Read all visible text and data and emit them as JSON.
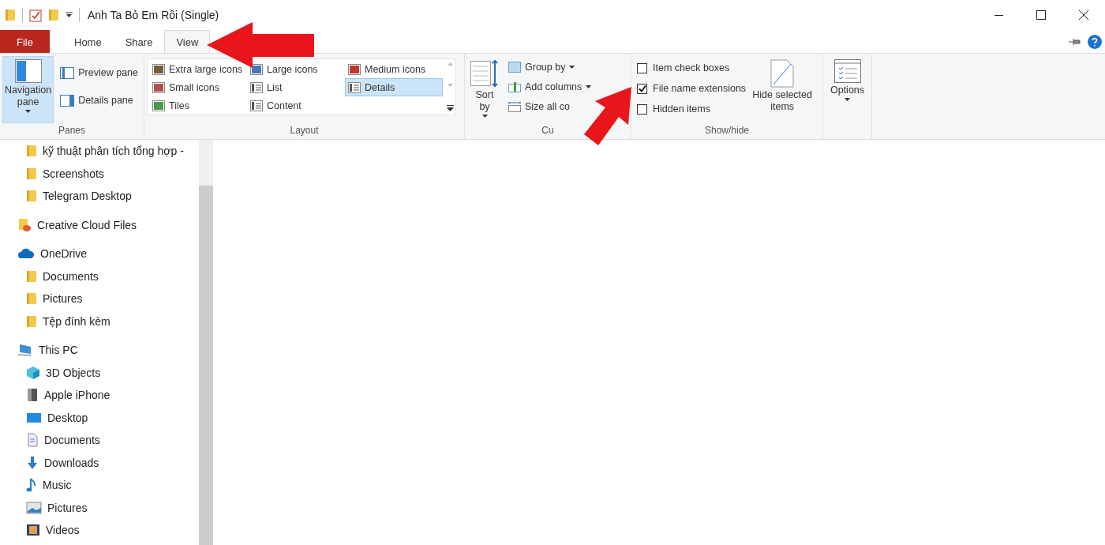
{
  "window": {
    "title": "Anh Ta Bỏ Em Rồi (Single)"
  },
  "tabs": [
    {
      "label": "File",
      "kind": "file",
      "selected": false
    },
    {
      "label": "Home",
      "kind": "tab",
      "selected": false
    },
    {
      "label": "Share",
      "kind": "tab",
      "selected": false
    },
    {
      "label": "View",
      "kind": "tab",
      "selected": true
    }
  ],
  "ribbon": {
    "panes": {
      "label": "Panes",
      "large": {
        "label": "Navigation pane",
        "on": true
      },
      "buttons": [
        {
          "label": "Preview pane",
          "kind": "preview",
          "on": false
        },
        {
          "label": "Details pane",
          "kind": "details",
          "on": false
        }
      ]
    },
    "layout": {
      "label": "Layout",
      "options": [
        {
          "label": "Extra large icons",
          "kind": "xl",
          "selected": false
        },
        {
          "label": "Large icons",
          "kind": "large",
          "selected": false
        },
        {
          "label": "Medium icons",
          "kind": "medium",
          "selected": false
        },
        {
          "label": "Small icons",
          "kind": "small",
          "selected": false
        },
        {
          "label": "List",
          "kind": "list",
          "selected": false
        },
        {
          "label": "Details",
          "kind": "details",
          "selected": true
        },
        {
          "label": "Tiles",
          "kind": "tiles",
          "selected": false
        },
        {
          "label": "Content",
          "kind": "content",
          "selected": false
        }
      ]
    },
    "current_view": {
      "label": "Cu",
      "sort": "Sort by",
      "buttons": [
        {
          "label": "Group by",
          "kind": "group",
          "dropdown": true
        },
        {
          "label": "Add columns",
          "kind": "add",
          "dropdown": true
        },
        {
          "label": "Size all co",
          "kind": "size",
          "dropdown": false
        }
      ]
    },
    "show_hide": {
      "label": "Show/hide",
      "checkboxes": [
        {
          "label": "Item check boxes",
          "checked": false
        },
        {
          "label": "File name extensions",
          "checked": true
        },
        {
          "label": "Hidden items",
          "checked": false
        }
      ],
      "hide_selected": "Hide selected items"
    },
    "options": {
      "label": "Options"
    }
  },
  "nav_pane": {
    "quick_access_items": [
      {
        "label": "kỹ thuật phân tích tổng hợp -",
        "kind": "folder"
      },
      {
        "label": "Screenshots",
        "kind": "folder"
      },
      {
        "label": "Telegram Desktop",
        "kind": "folder"
      }
    ],
    "tree": [
      {
        "label": "Creative Cloud Files",
        "kind": "creative-cloud"
      },
      {
        "label": "OneDrive",
        "kind": "cloud",
        "children": [
          {
            "label": "Documents",
            "kind": "folder"
          },
          {
            "label": "Pictures",
            "kind": "folder"
          },
          {
            "label": "Tệp đính kèm",
            "kind": "folder"
          }
        ]
      },
      {
        "label": "This PC",
        "kind": "pc",
        "children": [
          {
            "label": "3D Objects",
            "kind": "cube"
          },
          {
            "label": "Apple iPhone",
            "kind": "phone"
          },
          {
            "label": "Desktop",
            "kind": "desktop"
          },
          {
            "label": "Documents",
            "kind": "document"
          },
          {
            "label": "Downloads",
            "kind": "download"
          },
          {
            "label": "Music",
            "kind": "music"
          },
          {
            "label": "Pictures",
            "kind": "image"
          },
          {
            "label": "Videos",
            "kind": "video"
          }
        ]
      }
    ]
  }
}
